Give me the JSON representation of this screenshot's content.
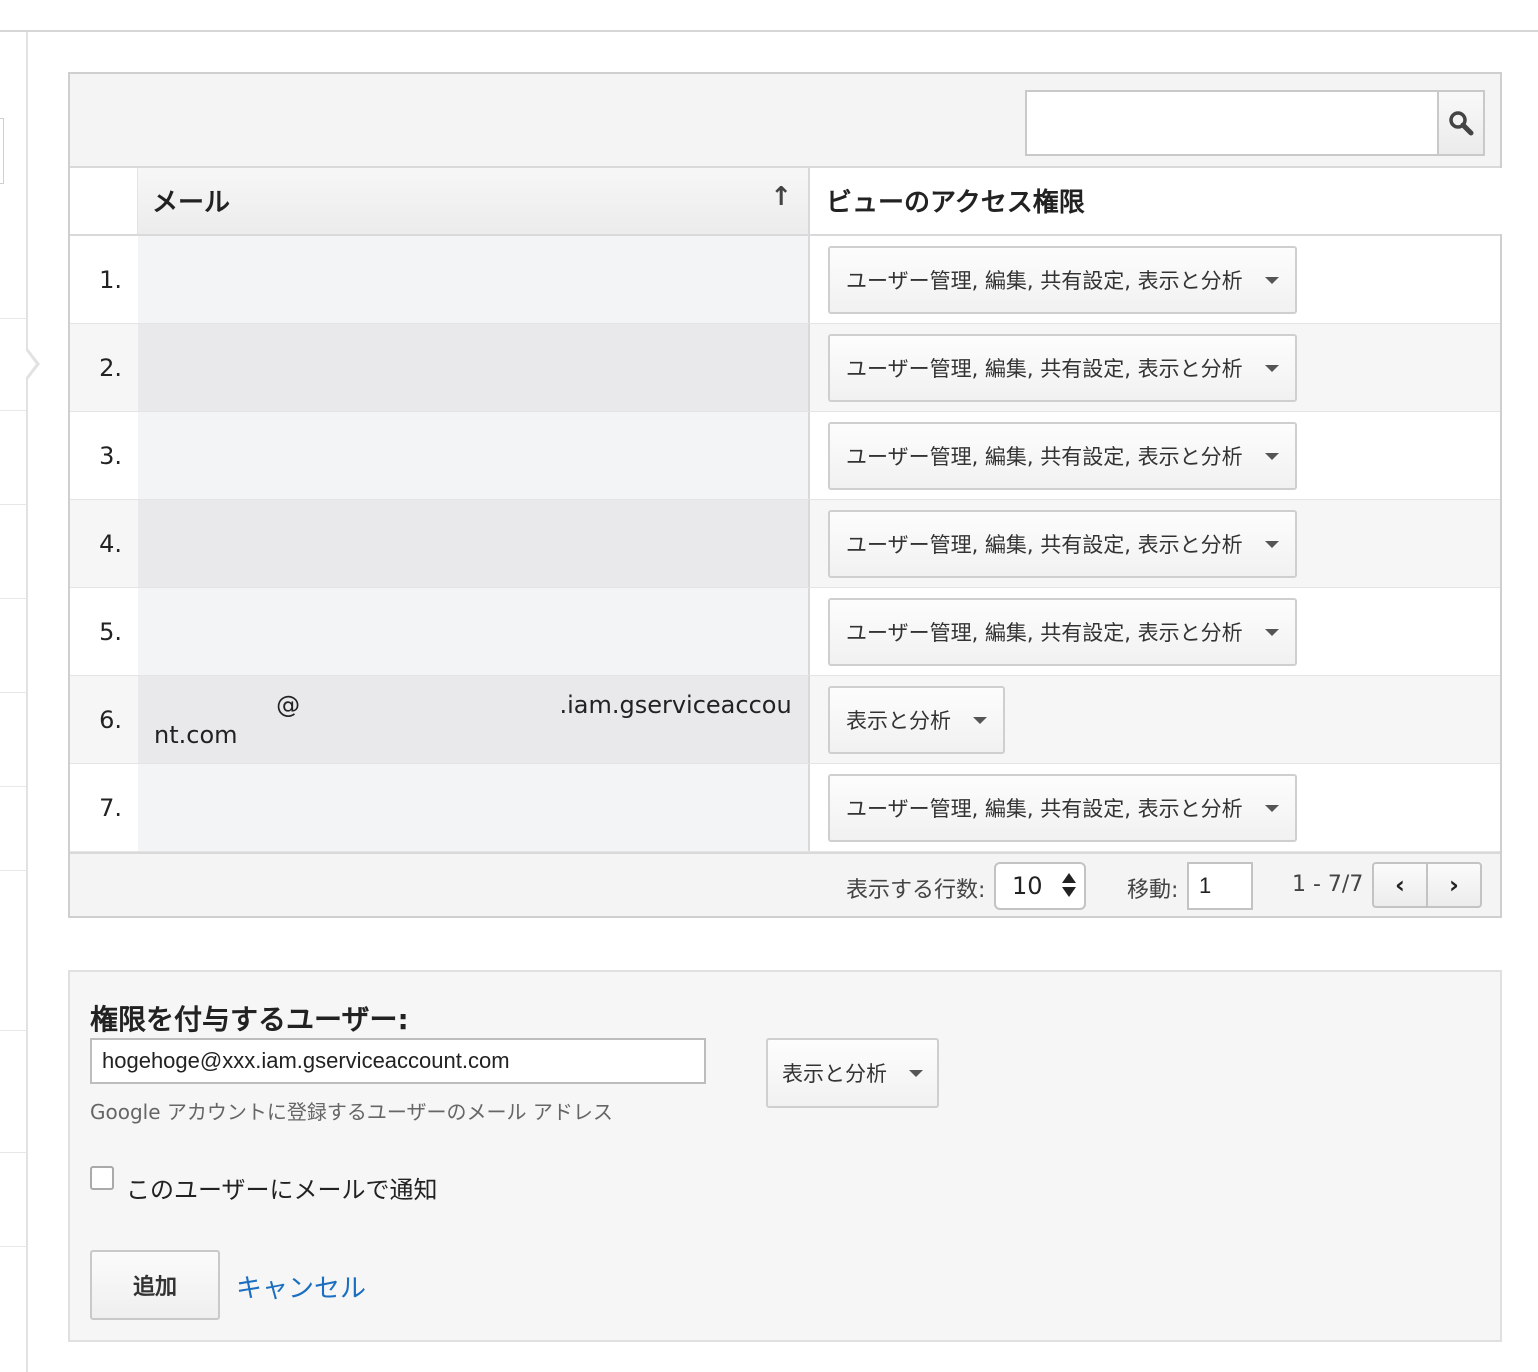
{
  "table": {
    "search": {
      "value": "",
      "placeholder": ""
    },
    "columns": {
      "email": "メール",
      "sort_icon": "arrow-up-icon",
      "access": "ビューのアクセス権限"
    },
    "rows": [
      {
        "num": "1.",
        "email": "",
        "access": "ユーザー管理, 編集, 共有設定, 表示と分析"
      },
      {
        "num": "2.",
        "email": "",
        "access": "ユーザー管理, 編集, 共有設定, 表示と分析"
      },
      {
        "num": "3.",
        "email": "",
        "access": "ユーザー管理, 編集, 共有設定, 表示と分析"
      },
      {
        "num": "4.",
        "email": "",
        "access": "ユーザー管理, 編集, 共有設定, 表示と分析"
      },
      {
        "num": "5.",
        "email": "",
        "access": "ユーザー管理, 編集, 共有設定, 表示と分析"
      },
      {
        "num": "6.",
        "email": "                @                                  .iam.gserviceaccount.com",
        "access": "表示と分析"
      },
      {
        "num": "7.",
        "email": "",
        "access": "ユーザー管理, 編集, 共有設定, 表示と分析"
      }
    ],
    "pager": {
      "rows_label": "表示する行数:",
      "rows_value": "10",
      "goto_label": "移動:",
      "goto_value": "1",
      "range": "1 - 7/7",
      "prev_icon": "chevron-left-icon",
      "next_icon": "chevron-right-icon"
    }
  },
  "add_user": {
    "title": "権限を付与するユーザー:",
    "email_value": "hogehoge@xxx.iam.gserviceaccount.com",
    "hint": "Google アカウントに登録するユーザーのメール アドレス",
    "permission": "表示と分析",
    "notify_label": "このユーザーにメールで通知",
    "notify_checked": false,
    "add_label": "追加",
    "cancel_label": "キャンセル"
  },
  "colors": {
    "link": "#1a6fc0",
    "border": "#cfcfcf",
    "panel": "#f4f4f4"
  }
}
